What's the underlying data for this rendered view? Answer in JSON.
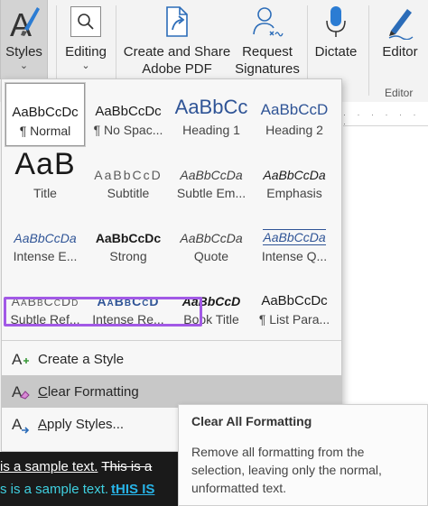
{
  "ribbon": {
    "styles_label": "Styles",
    "editing_label": "Editing",
    "create_share_line1": "Create and Share",
    "create_share_line2": "Adobe PDF",
    "request_line1": "Request",
    "request_line2": "Signatures",
    "dictate_label": "Dictate",
    "editor_label": "Editor",
    "editor_group_label": "Editor"
  },
  "gallery": {
    "styles": [
      {
        "preview": "AaBbCcDc",
        "name": "¶ Normal"
      },
      {
        "preview": "AaBbCcDc",
        "name": "¶ No Spac..."
      },
      {
        "preview": "AaBbCc",
        "name": "Heading 1"
      },
      {
        "preview": "AaBbCcD",
        "name": "Heading 2"
      },
      {
        "preview": "AaB",
        "name": "Title"
      },
      {
        "preview": "AaBbCcD",
        "name": "Subtitle"
      },
      {
        "preview": "AaBbCcDa",
        "name": "Subtle Em..."
      },
      {
        "preview": "AaBbCcDa",
        "name": "Emphasis"
      },
      {
        "preview": "AaBbCcDa",
        "name": "Intense E..."
      },
      {
        "preview": "AaBbCcDc",
        "name": "Strong"
      },
      {
        "preview": "AaBbCcDa",
        "name": "Quote"
      },
      {
        "preview": "AaBbCcDa",
        "name": "Intense Q..."
      },
      {
        "preview": "AaBbCcDd",
        "name": "Subtle Ref..."
      },
      {
        "preview": "AaBbCcD",
        "name": "Intense Re..."
      },
      {
        "preview": "AaBbCcD",
        "name": "Book Title"
      },
      {
        "preview": "AaBbCcDc",
        "name": "¶ List Para..."
      }
    ]
  },
  "menu": {
    "create_style": {
      "before": "",
      "accel": "",
      "label": "Create a Style"
    },
    "clear_formatting": {
      "accel": "C",
      "rest": "lear Formatting"
    },
    "apply_styles": {
      "accel": "A",
      "rest": "pply Styles..."
    }
  },
  "tooltip": {
    "title": "Clear All Formatting",
    "body": "Remove all formatting from the selection, leaving only the normal, unformatted text."
  },
  "document": {
    "line1_underlined": "is a sample text.",
    "line1_struck": "This is a",
    "line2_text": "s is a sample text.",
    "line2_caps": "tHIS IS"
  },
  "colors": {
    "accent_blue": "#2f5496",
    "highlight_purple": "#a259e6"
  }
}
